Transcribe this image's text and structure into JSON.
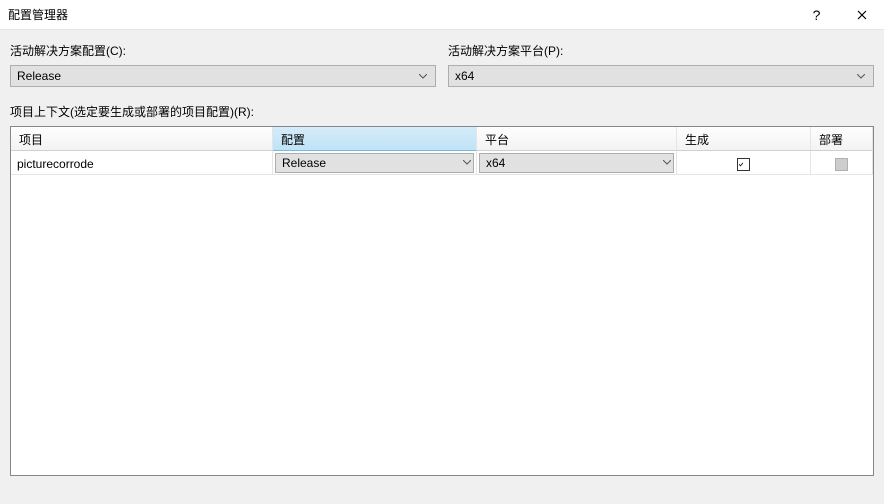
{
  "window": {
    "title": "配置管理器",
    "help_label": "?",
    "close_label": "✕"
  },
  "fields": {
    "config_label": "活动解决方案配置(C):",
    "config_value": "Release",
    "platform_label": "活动解决方案平台(P):",
    "platform_value": "x64"
  },
  "section_label": "项目上下文(选定要生成或部署的项目配置)(R):",
  "columns": {
    "project": "项目",
    "config": "配置",
    "platform": "平台",
    "build": "生成",
    "deploy": "部署"
  },
  "rows": [
    {
      "project": "picturecorrode",
      "config": "Release",
      "platform": "x64",
      "build": true,
      "deploy_disabled": true
    }
  ]
}
